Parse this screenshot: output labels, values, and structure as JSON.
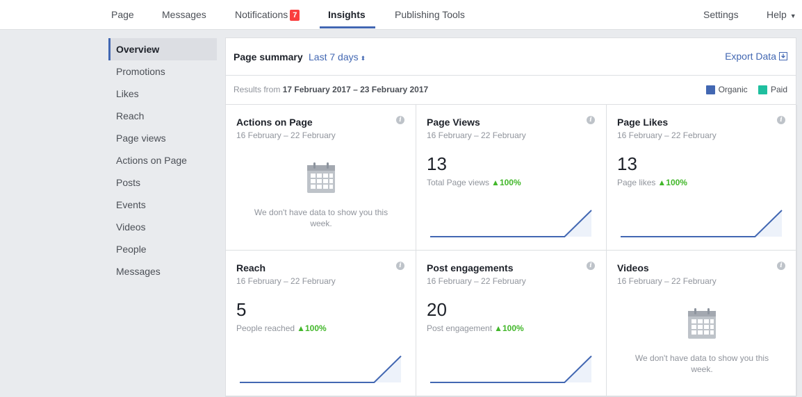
{
  "topnav": {
    "page": "Page",
    "messages": "Messages",
    "notifications": "Notifications",
    "notifications_count": "7",
    "insights": "Insights",
    "publishing_tools": "Publishing Tools",
    "settings": "Settings",
    "help": "Help"
  },
  "sidebar": {
    "items": [
      {
        "label": "Overview"
      },
      {
        "label": "Promotions"
      },
      {
        "label": "Likes"
      },
      {
        "label": "Reach"
      },
      {
        "label": "Page views"
      },
      {
        "label": "Actions on Page"
      },
      {
        "label": "Posts"
      },
      {
        "label": "Events"
      },
      {
        "label": "Videos"
      },
      {
        "label": "People"
      },
      {
        "label": "Messages"
      }
    ]
  },
  "summary": {
    "title": "Page summary",
    "range": "Last 7 days",
    "export": "Export Data",
    "results_prefix": "Results from",
    "results_range": "17 February 2017 – 23 February 2017",
    "legend": [
      {
        "label": "Organic",
        "color": "#4267b2"
      },
      {
        "label": "Paid",
        "color": "#1fbf9f"
      }
    ]
  },
  "cards": [
    {
      "title": "Actions on Page",
      "date": "16 February – 22 February",
      "empty_msg": "We don't have data to show you this week."
    },
    {
      "title": "Page Views",
      "date": "16 February – 22 February",
      "value": "13",
      "label": "Total Page views",
      "change": "100%",
      "trend": [
        0,
        0,
        0,
        0,
        0,
        0,
        1
      ]
    },
    {
      "title": "Page Likes",
      "date": "16 February – 22 February",
      "value": "13",
      "label": "Page likes",
      "change": "100%",
      "trend": [
        0,
        0,
        0,
        0,
        0,
        0,
        1
      ]
    },
    {
      "title": "Reach",
      "date": "16 February – 22 February",
      "value": "5",
      "label": "People reached",
      "change": "100%",
      "trend": [
        0,
        0,
        0,
        0,
        0,
        0,
        1
      ]
    },
    {
      "title": "Post engagements",
      "date": "16 February – 22 February",
      "value": "20",
      "label": "Post engagement",
      "change": "100%",
      "trend": [
        0,
        0,
        0,
        0,
        0,
        0,
        1
      ]
    },
    {
      "title": "Videos",
      "date": "16 February – 22 February",
      "empty_msg": "We don't have data to show you this week."
    }
  ],
  "icons": {
    "info": "info-icon",
    "calendar": "calendar-icon",
    "export": "download-icon",
    "up": "up-arrow-icon"
  }
}
